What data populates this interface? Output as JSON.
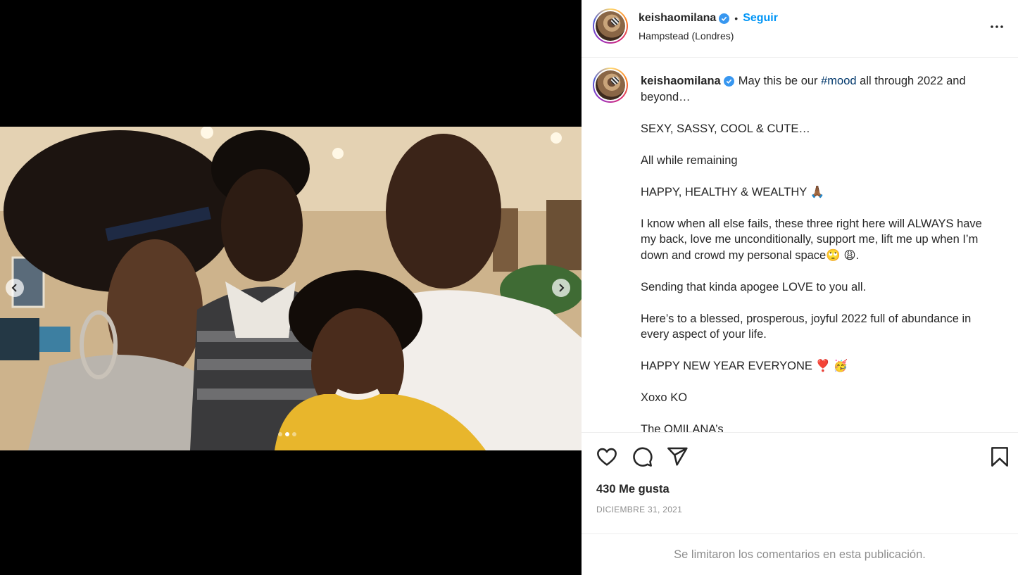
{
  "media": {
    "image_count": 3,
    "active_index": 1,
    "prev_icon": "chevron-left-icon",
    "next_icon": "chevron-right-icon"
  },
  "header": {
    "username": "keishaomilana",
    "verified": true,
    "separator": "•",
    "follow_label": "Seguir",
    "location": "Hampstead (Londres)",
    "more_icon": "more-options-icon"
  },
  "caption": {
    "username": "keishaomilana",
    "intro_before_hashtag": "May this be our ",
    "hashtag": "#mood",
    "intro_after_hashtag": " all through 2022 and beyond…",
    "paragraphs": [
      "SEXY, SASSY, COOL & CUTE…",
      "All while remaining",
      "HAPPY, HEALTHY & WEALTHY 🙏🏾",
      "I know when all else fails, these three right here will ALWAYS have my back, love me unconditionally, support me, lift me up when I’m down and crowd my personal space🙄 😩.",
      "Sending that kinda apogee LOVE to you all.",
      "Here’s to a blessed, prosperous, joyful 2022 full of abundance in every aspect of your life.",
      "HAPPY NEW YEAR EVERYONE ❣️ 🥳",
      "Xoxo KO",
      "The OMILANA’s"
    ]
  },
  "actions": {
    "like_icon": "heart-icon",
    "comment_icon": "comment-icon",
    "share_icon": "share-icon",
    "save_icon": "bookmark-icon",
    "likes_text": "430 Me gusta",
    "date_text": "DICIEMBRE 31, 2021"
  },
  "footer": {
    "comments_limited": "Se limitaron los comentarios en esta publicación."
  },
  "colors": {
    "link_blue": "#0095f6",
    "hashtag_blue": "#00376b",
    "muted_gray": "#8e8e8e",
    "text": "#262626",
    "verified_blue": "#3897f0"
  }
}
